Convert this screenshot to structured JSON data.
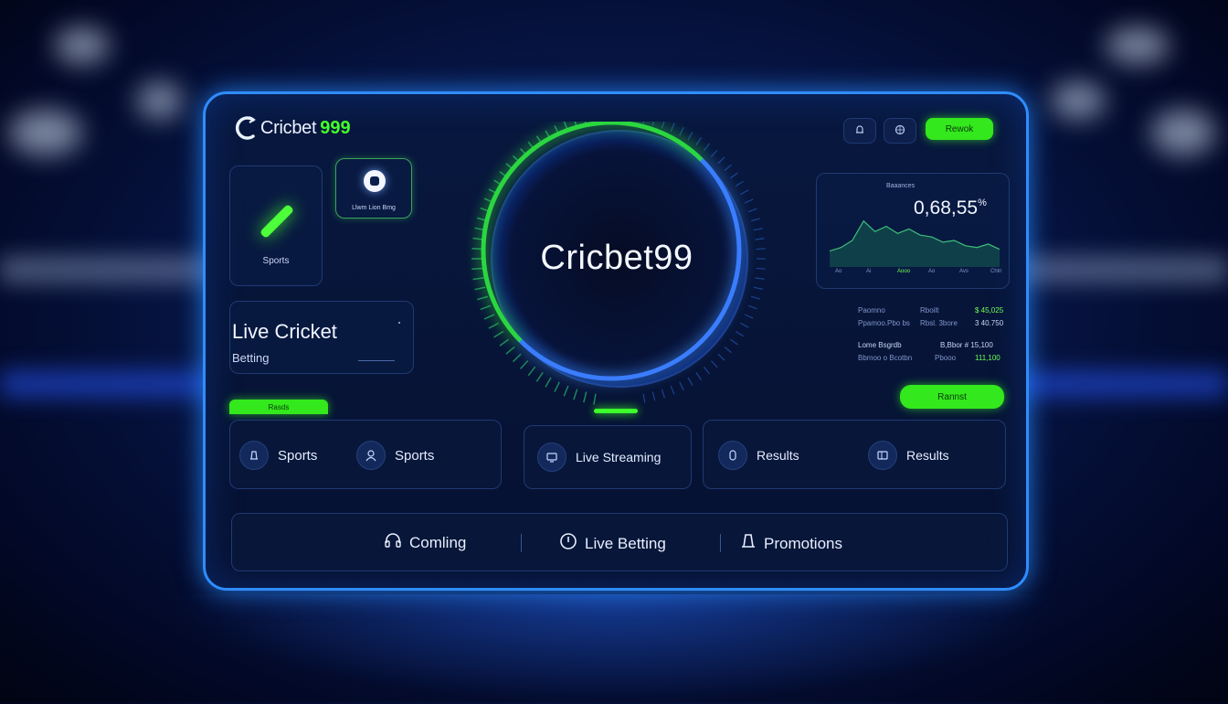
{
  "app": {
    "brand_left": "Cricbet",
    "brand_right": "999",
    "center_title": "Cricbet99"
  },
  "header": {
    "bell_icon": "bell-icon",
    "globe_icon": "globe-icon",
    "green_button_label": "Rewok"
  },
  "left_cards": {
    "sports_card_label": "Sports",
    "small_card_label": "Llwm Lion Bmg"
  },
  "live_card": {
    "title": "Live Cricket",
    "subtitle": "Betting"
  },
  "chart_card": {
    "caption": "Baaances",
    "value": "0,68,55",
    "suffix": "%",
    "x_labels": [
      "Ao",
      "Ai",
      "Aooo",
      "Ao",
      "Avs",
      "Chln"
    ]
  },
  "chart_data": {
    "type": "area",
    "y": [
      18,
      22,
      30,
      52,
      40,
      46,
      38,
      43,
      36,
      34,
      28,
      30,
      24,
      22,
      26,
      20
    ],
    "ylim": [
      0,
      60
    ],
    "color": "#1e8a5a"
  },
  "stats": {
    "row1": [
      "Paomno",
      "Rboilt",
      "$ 45,025"
    ],
    "row2": [
      "Ppamoo.Pbo bs",
      "Rbsl. 3bore",
      "3 40.750"
    ],
    "row3": [
      "Lome Bsgrdb",
      "B,Bbor # 15,100"
    ],
    "row4": [
      "Bbmoo o Bcotbn",
      "Pbooo",
      "111,100"
    ]
  },
  "actions": {
    "green_tab_label": "Rasds",
    "green_action_label": "Rannst"
  },
  "nav": {
    "sports_1": "Sports",
    "sports_2": "Sports",
    "live_streaming": "Live Streaming",
    "results_1": "Results",
    "results_2": "Results"
  },
  "bottom": {
    "coming": "Comling",
    "live_betting": "Live Betting",
    "promotions": "Promotions"
  },
  "colors": {
    "accent_green": "#44ff2a",
    "accent_blue": "#2f8dff",
    "panel_bg": "#08183f"
  }
}
